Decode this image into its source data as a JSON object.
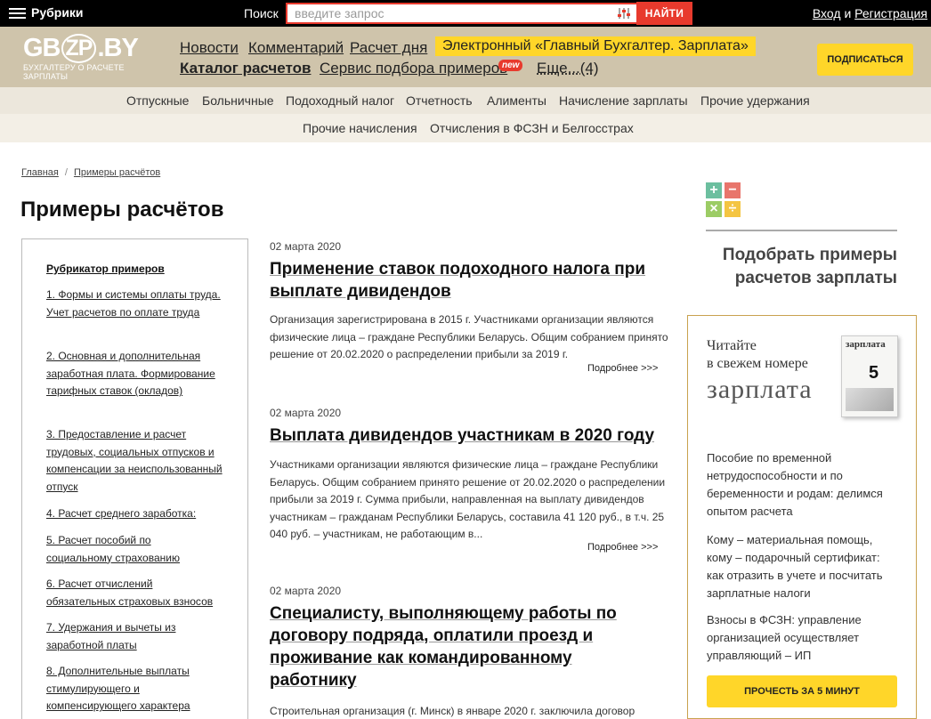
{
  "topbar": {
    "rubriki_label": "Рубрики",
    "search_label": "Поиск",
    "search_placeholder": "введите запрос",
    "search_button": "НАЙТИ",
    "login": "Вход",
    "and": "и",
    "register": "Регистрация"
  },
  "header": {
    "logo_pre": "GB",
    "logo_mid": "ZP",
    "logo_post": ".BY",
    "logo_tagline": "БУХГАЛТЕРУ О РАСЧЕТЕ ЗАРПЛАТЫ",
    "nav": {
      "news": "Новости",
      "comments": "Комментарий",
      "calc_day": "Расчет дня",
      "promo": "Электронный «Главный Бухгалтер. Зарплата»",
      "catalog": "Каталог расчетов",
      "service": "Сервис подбора примеров",
      "new_badge": "new",
      "more": "Еще...(4)"
    },
    "subscribe": "ПОДПИСАТЬСЯ"
  },
  "categories": {
    "row1": [
      "Отпускные",
      "Больничные",
      "Подоходный налог",
      "Отчетность",
      "Алименты",
      "Начисление зарплаты",
      "Прочие удержания"
    ],
    "row2": [
      "Прочие начисления",
      "Отчисления в ФСЗН и Белгосстрах"
    ]
  },
  "breadcrumb": {
    "home": "Главная",
    "sep": "/",
    "current": "Примеры расчётов"
  },
  "page_title": "Примеры расчётов",
  "rubricator": {
    "title": "Рубрикатор примеров",
    "items": [
      "1. Формы и системы оплаты труда. Учет расчетов по оплате труда",
      "2. Основная и дополнительная заработная плата. Формирование тарифных ставок (окладов)",
      "3. Предоставление и расчет трудовых, социальных отпусков и компенсации за неиспользованный отпуск",
      "4. Расчет среднего заработка:",
      "5. Расчет пособий по социальному страхованию",
      "6. Расчет отчислений обязательных страховых взносов",
      "7. Удержания и вычеты из заработной платы",
      "8. Дополнительные выплаты стимулирующего и компенсирующего характера"
    ]
  },
  "articles": [
    {
      "date": "02 марта 2020",
      "title": "Применение ставок подоходного налога при выплате дивидендов",
      "text": "Организация зарегистрирована в 2015 г. Участниками организации являются физические лица – граждане Республики Беларусь. Общим собранием принято решение от 20.02.2020 о распределении прибыли за 2019 г.",
      "more": "Подробнее >>>"
    },
    {
      "date": "02 марта 2020",
      "title": "Выплата дивидендов участникам в 2020 году",
      "text": "Участниками организации являются физические лица – граждане Республики Беларусь. Общим собранием принято решение от 20.02.2020 о распределении прибыли за 2019 г. Сумма прибыли, направленная на выплату дивидендов участникам – гражданам Республики Беларусь, составила 41 120 руб., в т.ч. 25 040 руб. – участникам, не работающим в...",
      "more": "Подробнее >>>"
    },
    {
      "date": "02 марта 2020",
      "title": "Специалисту, выполняющему работы по договору подряда, оплатили проезд и проживание как командированному работнику",
      "text": "Строительная организация (г. Минск) в январе 2020 г. заключила договор"
    }
  ],
  "right": {
    "icon_plus": "+",
    "icon_minus": "−",
    "icon_times": "×",
    "icon_div": "÷",
    "heading": "Подобрать примеры расчетов зарплаты",
    "magazine": {
      "read_line1": "Читайте",
      "read_line2": "в свежем номере",
      "name": "зарплата",
      "cover_title": "зарплата",
      "cover_number": "5",
      "links": [
        "Пособие по временной нетрудоспособности и по беременности и родам: делимся опытом расчета",
        "Кому – материальная помощь, кому – подарочный сертификат: как отразить в учете и посчитать зарплатные налоги",
        "Взносы в ФСЗН: управление организацией осуществляет управляющий – ИП"
      ],
      "button": "ПРОЧЕСТЬ ЗА 5 МИНУТ"
    }
  },
  "colors": {
    "accent_red": "#e83a2d",
    "accent_yellow": "#ffd629",
    "header_bg": "#cfc4ab"
  }
}
